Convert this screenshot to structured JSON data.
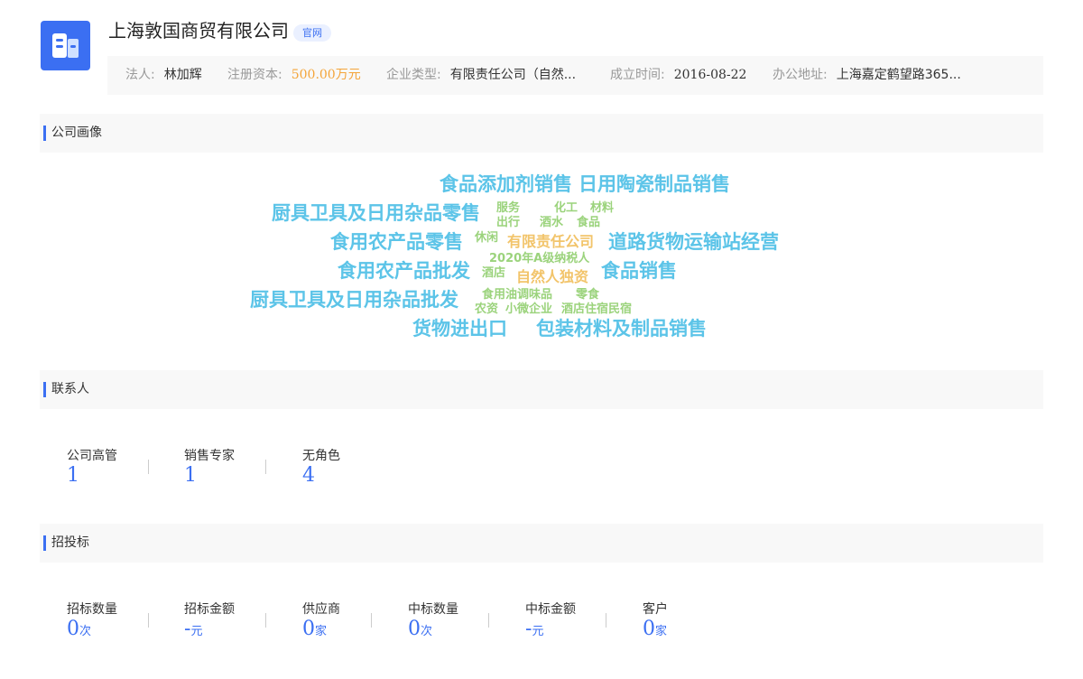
{
  "company": {
    "logo_icon": "building-icon",
    "name": "上海敦国商贸有限公司",
    "website_badge": "官网"
  },
  "info": {
    "legal_rep_label": "法人:",
    "legal_rep_value": "林加辉",
    "capital_label": "注册资本:",
    "capital_value": "500.00万元",
    "type_label": "企业类型:",
    "type_value": "有限责任公司（自然...",
    "founded_label": "成立时间:",
    "founded_value": "2016-08-22",
    "address_label": "办公地址:",
    "address_value": "上海嘉定鹤望路365..."
  },
  "sections": {
    "portrait_title": "公司画像",
    "contacts_title": "联系人",
    "bidding_title": "招投标"
  },
  "word_cloud": {
    "colors": {
      "blue": "#5cc4e8",
      "green": "#9bd37c",
      "orange": "#f2c46a"
    },
    "words": [
      "食品添加剂销售",
      "日用陶瓷制品销售",
      "厨具卫具及日用杂品零售",
      "服务",
      "化工",
      "材料",
      "出行",
      "酒水",
      "食品",
      "食用农产品零售",
      "休闲",
      "有限责任公司",
      "道路货物运输站经营",
      "2020年A级纳税人",
      "食用农产品批发",
      "酒店",
      "自然人独资",
      "食品销售",
      "厨具卫具及日用杂品批发",
      "食用油调味品",
      "零食",
      "农资",
      "小微企业",
      "酒店住宿民宿",
      "货物进出口",
      "包装材料及制品销售"
    ]
  },
  "contacts": [
    {
      "label": "公司高管",
      "value": "1"
    },
    {
      "label": "销售专家",
      "value": "1"
    },
    {
      "label": "无角色",
      "value": "4"
    }
  ],
  "bidding": [
    {
      "label": "招标数量",
      "value": "0",
      "unit": "次"
    },
    {
      "label": "招标金额",
      "value": "-",
      "unit": "元"
    },
    {
      "label": "供应商",
      "value": "0",
      "unit": "家"
    },
    {
      "label": "中标数量",
      "value": "0",
      "unit": "次"
    },
    {
      "label": "中标金额",
      "value": "-",
      "unit": "元"
    },
    {
      "label": "客户",
      "value": "0",
      "unit": "家"
    }
  ],
  "accent_color": "#3b6ff2"
}
